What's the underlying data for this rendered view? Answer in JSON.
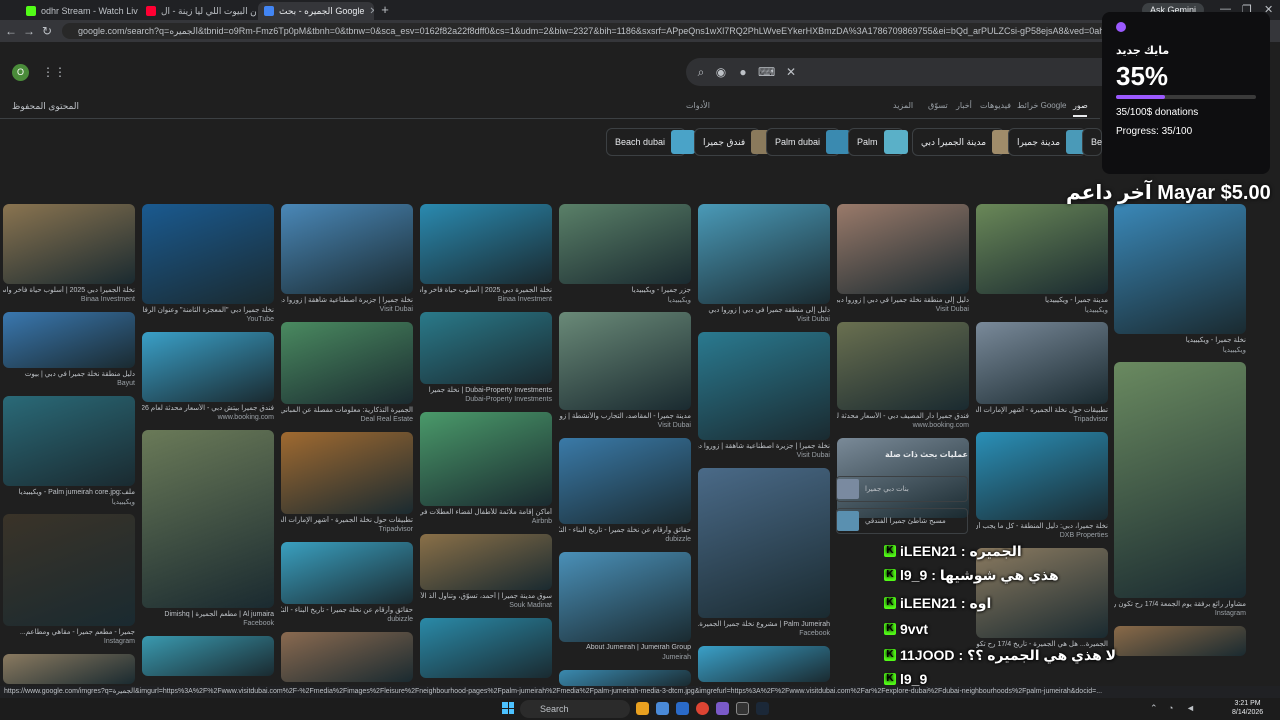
{
  "tabs": [
    {
      "title": "odhr Stream - Watch Live on Ki",
      "fav_color": "#53fc18"
    },
    {
      "title": "يا دار وين البيوت اللي ليا زينة - ال",
      "fav_color": "#ff0033"
    },
    {
      "title": "الجميره - بحث Google",
      "fav_color": "#4285f4"
    }
  ],
  "new_tab": "+",
  "ask_gemini": "Ask Gemini",
  "window_controls": {
    "minimize": "—",
    "restore": "❐",
    "close": "✕"
  },
  "url": "google.com/search?q=الجميره&tbnid=o9Rm-Fmz6Tp0pM&tbnh=0&tbnw=0&sca_esv=0162f82a22f8dff0&cs=1&udm=2&biw=2327&bih=1186&sxsrf=APpeQns1wXl7RQ2PhLWveEYkerHXBmzDA%3A1786709869755&ei=bQd_arPULZCsi-gP58ejsA8&ved=0ahUKEwjzvun4jYGRAxWQUQ1gIHHefjCNYQ4dUDCBE&uact=5&oq=الجميره&gs_l",
  "profile_initial": "O",
  "search_icons": [
    "search-icon",
    "lens-icon",
    "mic-icon",
    "keyboard-icon",
    "clear-icon"
  ],
  "saved_content": "المحتوى المحفوظ",
  "tools": "الأدوات",
  "filter_tabs": [
    "صور",
    "خرائط Google",
    "فيديوهات",
    "أخبار",
    "تسوّق",
    "المزيد"
  ],
  "chips": [
    "Beach dubai",
    "فندق جميرا",
    "Palm dubai",
    "Palm",
    "مدينة الجميرا دبي",
    "مدينة جميرا",
    "Beach"
  ],
  "chip_colors": [
    "#4aa3c8",
    "#8a7a5c",
    "#3a8ab0",
    "#5ab0c8",
    "#a08c6a",
    "#4a9ab8",
    "#3a90c0"
  ],
  "grid": [
    {
      "col": 0,
      "items": [
        {
          "caption": "نخلة الجميرا دبي 2025 | أسلوب حياة فاخر واستثمار رائع",
          "source": "Binaa Investment",
          "color": "#8a7450",
          "h": 80
        },
        {
          "caption": "دليل منطقة نخلة جميرا في دبي | بيوت",
          "source": "Bayut",
          "color": "#3a78b0",
          "h": 56
        },
        {
          "caption": "ملف:Palm jumeirah core.jpg - ويكيبيديا",
          "source": "ويكيبيديا",
          "color": "#2a6a78",
          "h": 90
        },
        {
          "caption": "جميرا - مطعم جميرا - مقاهي ومطاعم...",
          "source": "Instagram",
          "color": "#3a3328",
          "h": 112
        },
        {
          "caption": "",
          "source": "",
          "color": "#8a7a60",
          "h": 30
        }
      ]
    },
    {
      "col": 1,
      "items": [
        {
          "caption": "نخلة جميرا دبي \"المعجزة الثامنة\" وعنوان الرفاهية...",
          "source": "YouTube",
          "color": "#1a5a90",
          "h": 100
        },
        {
          "caption": "فندق جميرا بيتش دبي - الأسعار محدثة لعام 2026",
          "source": "www.booking.com",
          "color": "#3aa0c8",
          "h": 70
        },
        {
          "caption": "Al jumaira | مطعم الجميرة | Dimishq",
          "source": "Facebook",
          "color": "#6a7a58",
          "h": 178
        },
        {
          "caption": "",
          "source": "",
          "color": "#3a9ab0",
          "h": 40
        }
      ]
    },
    {
      "col": 2,
      "items": [
        {
          "caption": "نخلة جميرا | جزيرة اصطناعية شاهقة | زوروا دبي",
          "source": "Visit Dubai",
          "color": "#4a88b8",
          "h": 90
        },
        {
          "caption": "الجميرة التذكارية: معلومات مفصلة عن المباني والاستثمار في...",
          "source": "Deal Real Estate",
          "color": "#4a8a60",
          "h": 82
        },
        {
          "caption": "تطبيقات حول نخلة الجميرة - أشهر الإمارات العربية المتحدة",
          "source": "Tripadvisor",
          "color": "#a06a30",
          "h": 82
        },
        {
          "caption": "حقائق وأرقام عن نخلة جميرا - تاريخ البناء - التكلفة - مطعم...",
          "source": "dubizzle",
          "color": "#3aa0c0",
          "h": 62
        },
        {
          "caption": "",
          "source": "",
          "color": "#8a6a50",
          "h": 50
        }
      ]
    },
    {
      "col": 3,
      "items": [
        {
          "caption": "نخلة الجميرة دبي 2025 | أسلوب حياة فاخر واستثمار رائع",
          "source": "Binaa Investment",
          "color": "#2a8ab0",
          "h": 80
        },
        {
          "caption": "Dubai-Property Investments | نخلة جميرا",
          "source": "Dubai-Property Investments",
          "color": "#2a7a8a",
          "h": 72
        },
        {
          "caption": "أماكن إقامة ملائمة للأطفال لقضاء العطلات في نخلة الجميرة...",
          "source": "Airbnb",
          "color": "#4a9a6a",
          "h": 94
        },
        {
          "caption": "سوق مدينة جميرا | أحمد، تسوّق، وتناول ألذ الأطعمة",
          "source": "Souk Madinat",
          "color": "#8a7048",
          "h": 56
        },
        {
          "caption": "",
          "source": "",
          "color": "#2a8aa8",
          "h": 60
        }
      ]
    },
    {
      "col": 4,
      "items": [
        {
          "caption": "جزر جميرا - ويكيبيديا",
          "source": "ويكيبيديا",
          "color": "#5a8068",
          "h": 80
        },
        {
          "caption": "مدينة جميرا - المقاصد، التجارب والأنشطة | زوروا دبي",
          "source": "Visit Dubai",
          "color": "#6a8a78",
          "h": 98
        },
        {
          "caption": "حقائق وأرقام عن نخلة جميرا - تاريخ البناء - التكلفة - مطعم...",
          "source": "dubizzle",
          "color": "#3a7aa8",
          "h": 86
        },
        {
          "caption": "About Jumeirah | Jumeirah Group",
          "source": "Jumeirah",
          "color": "#4a90b8",
          "h": 90
        },
        {
          "caption": "",
          "source": "",
          "color": "#3a8ab0",
          "h": 20
        }
      ]
    },
    {
      "col": 5,
      "items": [
        {
          "caption": "دليل إلى منطقة جميرا في دبي | زوروا دبي",
          "source": "Visit Dubai",
          "color": "#4a9ab8",
          "h": 100
        },
        {
          "caption": "نخلة جميرا | جزيرة اصطناعية شاهقة | زوروا دبي",
          "source": "Visit Dubai",
          "color": "#2a7a90",
          "h": 108
        },
        {
          "caption": "Palm Jumeirah | مشروع نخلة جميرا الجميرة...",
          "source": "Facebook",
          "color": "#4a6a88",
          "h": 150
        },
        {
          "caption": "",
          "source": "",
          "color": "#3aa0c8",
          "h": 36
        }
      ]
    },
    {
      "col": 6,
      "items": [
        {
          "caption": "دليل إلى منطقة نخلة جميرا في دبي | زوروا دبي",
          "source": "Visit Dubai",
          "color": "#9a7a6a",
          "h": 90
        },
        {
          "caption": "فندق جميرا دار المصيف دبي - الأسعار محدثة لعام 2026",
          "source": "www.booking.com",
          "color": "#6a7050",
          "h": 88
        },
        {
          "caption": "",
          "source": "",
          "color": "#7a8a98",
          "h": 80
        }
      ]
    },
    {
      "col": 7,
      "items": [
        {
          "caption": "مدينة جميرا - ويكيبيديا",
          "source": "ويكيبيديا",
          "color": "#6a8858",
          "h": 90
        },
        {
          "caption": "تطبيقات حول نخلة الجميرة - أشهر الإمارات العربية المتحدة",
          "source": "Tripadvisor",
          "color": "#7a8a9a",
          "h": 82
        },
        {
          "caption": "نخلة جميرا، دبي: دليل المنطقة - كل ما يجب أن تعرفه",
          "source": "DXB Properties",
          "color": "#2a90b8",
          "h": 88
        },
        {
          "caption": "الجميرة... هل هي الجميرة - تاريخ 17/4 رح تكون...",
          "source": "",
          "color": "#8a7a60",
          "h": 90
        }
      ]
    },
    {
      "col": 8,
      "items": [
        {
          "caption": "نخلة جميرا - ويكيبيديا",
          "source": "ويكيبيديا",
          "color": "#3a88b8",
          "h": 130
        },
        {
          "caption": "مشاوار رائع برفقة يوم الجمعة 17/4 رح تكون رحلة في...",
          "source": "Instagram",
          "color": "#6a8a60",
          "h": 236
        },
        {
          "caption": "",
          "source": "",
          "color": "#8a6a48",
          "h": 30
        }
      ]
    }
  ],
  "related": {
    "title": "عمليات بحث ذات صلة",
    "items": [
      "بنات دبي جميرا",
      "مسبح شاطئ جميرا الفندقي"
    ]
  },
  "donation": {
    "title": "مايك جديد",
    "percent": "35%",
    "progress_fraction": 0.35,
    "summary": "35/100$ donations",
    "progress": "Progress: 35/100"
  },
  "last_supporter": "آخر داعم Mayar $5.00",
  "chat": [
    {
      "user": "iLEEN21",
      "msg": "الجميره"
    },
    {
      "user": "l9_9",
      "msg": "هذي هي شوشيها"
    },
    {
      "user": "iLEEN21",
      "msg": "اوه"
    },
    {
      "user": "9vvt",
      "msg": ""
    },
    {
      "user": "11JOOD",
      "msg": "لا هذي هي الجميره ؟؟"
    },
    {
      "user": "l9_9",
      "msg": ""
    },
    {
      "user": "9vvt",
      "msg": ""
    }
  ],
  "status_url": "https://www.google.com/imgres?q=الجميرة&imgurl=https%3A%2F%2Fwww.visitdubai.com%2F-%2Fmedia%2Fimages%2Fleisure%2Fneighbourhood-pages%2Fpalm-jumeirah%2Fmedia%2Fpalm-jumeirah-media-3-dtcm.jpg&imgrefurl=https%3A%2F%2Fwww.visitdubai.com%2Far%2Fexplore-dubai%2Fdubai-neighbourhoods%2Fpalm-jumeirah&docid=...",
  "taskbar": {
    "search": "Search",
    "time": "3:21 PM",
    "date": "8/14/2026"
  }
}
